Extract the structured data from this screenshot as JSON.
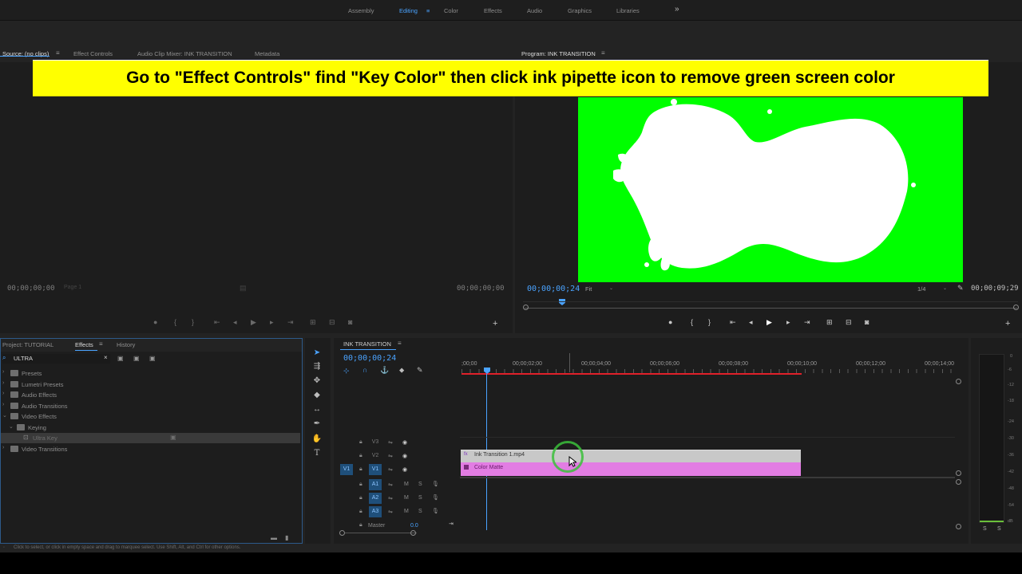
{
  "workspace": {
    "tabs": [
      "Assembly",
      "Editing",
      "Color",
      "Effects",
      "Audio",
      "Graphics",
      "Libraries"
    ],
    "active": "Editing",
    "more": "»"
  },
  "source_panel": {
    "tabs": [
      "Source: (no clips)",
      "Effect Controls",
      "Audio Clip Mixer: INK TRANSITION",
      "Metadata"
    ],
    "timecode_left": "00;00;00;00",
    "timecode_right": "00;00;00;00",
    "page_label": "Page 1"
  },
  "program_panel": {
    "title": "Program: INK TRANSITION",
    "timecode_current": "00;00;00;24",
    "fit": "Fit",
    "resolution": "1/4",
    "timecode_duration": "00;00;09;29"
  },
  "banner": {
    "text": "Go to \"Effect Controls\" find \"Key Color\" then click ink pipette icon to remove green screen color",
    "color": "#ffff00"
  },
  "project_panel": {
    "tabs": [
      "Project: TUTORIAL",
      "Effects",
      "History"
    ],
    "active": "Effects",
    "search_value": "ULTRA",
    "tree": [
      {
        "label": "Presets",
        "level": 0
      },
      {
        "label": "Lumetri Presets",
        "level": 0
      },
      {
        "label": "Audio Effects",
        "level": 0
      },
      {
        "label": "Audio Transitions",
        "level": 0
      },
      {
        "label": "Video Effects",
        "level": 0
      },
      {
        "label": "Keying",
        "level": 1
      },
      {
        "label": "Ultra Key",
        "level": 2
      },
      {
        "label": "Video Transitions",
        "level": 0
      }
    ]
  },
  "timeline": {
    "title": "INK TRANSITION",
    "timecode": "00;00;00;24",
    "ruler": [
      ";00;00",
      "00;00;02;00",
      "00;00;04;00",
      "00;00;06;00",
      "00;00;08;00",
      "00;00;10;00",
      "00;00;12;00",
      "00;00;14;00"
    ],
    "video_tracks": [
      "V3",
      "V2",
      "V1"
    ],
    "audio_tracks": [
      "A1",
      "A2",
      "A3"
    ],
    "source_patch": "V1",
    "master_label": "Master",
    "master_value": "0.0",
    "clips": [
      {
        "name": "Ink Transition 1.mp4",
        "track": "V2",
        "color": "#c8c8c8"
      },
      {
        "name": "Color Matte",
        "track": "V1",
        "color": "#e27de3"
      }
    ],
    "toggle_m": "M",
    "toggle_s": "S"
  },
  "meters": {
    "scale": [
      "0",
      "-6",
      "-12",
      "-18",
      "-24",
      "-30",
      "-36",
      "-42",
      "-48",
      "-54",
      "dB"
    ],
    "solo_labels": [
      "S",
      "S"
    ]
  },
  "status_bar": {
    "text": "Click to select, or click in empty space and drag to marquee select. Use Shift, Alt, and Ctrl for other options."
  }
}
